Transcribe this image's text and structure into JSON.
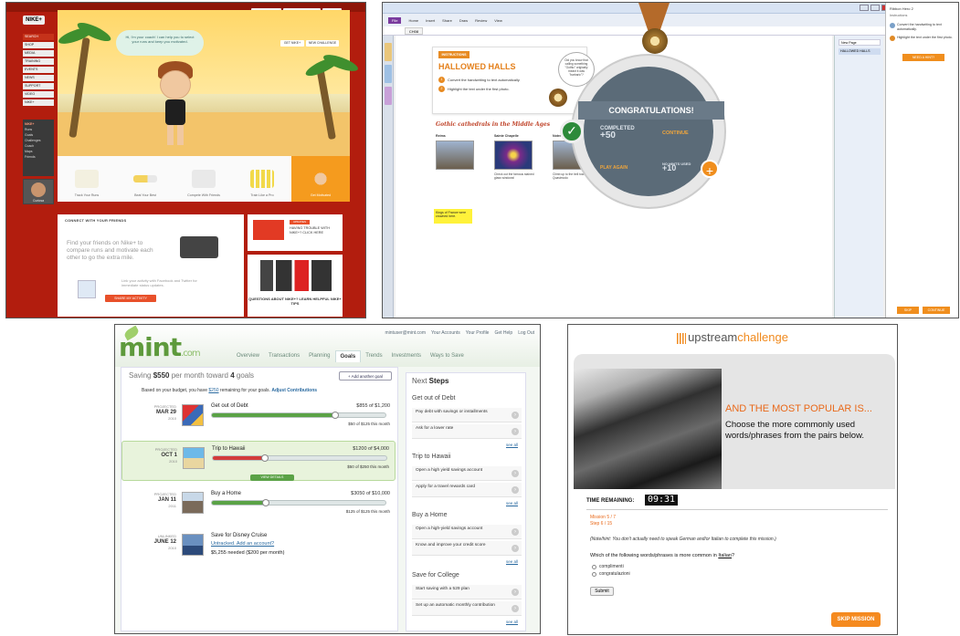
{
  "nike": {
    "logo": "NIKE+",
    "top_nav": [
      "NIKESTORE",
      "ORDER STATUS",
      "CART"
    ],
    "side_nav": [
      "SEARCH",
      "SHOP",
      "MEDIA",
      "TRAINING",
      "EVENTS",
      "NEWS",
      "SUPPORT",
      "VIDEO",
      "NIKE+"
    ],
    "side_sub_header": "NIKE+",
    "side_sub": [
      "Runs",
      "Goals",
      "Challenges",
      "Coach",
      "Maps",
      "Friends"
    ],
    "avatar_name": "Curiosa",
    "bubble": "Hi, I'm your coach! I can help you to select your runs and keep you motivated.",
    "btn_a": "GET NIKE+",
    "btn_b": "NEW CHALLENGE",
    "features": [
      "Track Your Runs",
      "Beat Your Best",
      "Compete With Friends",
      "Train Like a Pro",
      "Get Motivated"
    ],
    "connect_header": "CONNECT WITH YOUR FRIENDS",
    "connect_big": "Find your friends on Nike+ to compare runs and motivate each other to go the extra mile.",
    "connect_link": "Link your activity with Facebook and Twitter for immediate status updates.",
    "share_btn": "SHARE MY ACTIVITY",
    "promo1_tag": "UPDATES",
    "promo1_text": "HAVING TROUBLE WITH NIKE+? CLICK HERE",
    "promo2_text": "QUESTIONS ABOUT NIKE+? LEARN HELPFUL NIKE+ TIPS"
  },
  "onenote": {
    "window_title": "Ribbon Hero 2",
    "ribbon_tabs": [
      "File",
      "Home",
      "Insert",
      "Share",
      "Draw",
      "Review",
      "View"
    ],
    "section_tab": "CH08",
    "instructions_label": "INSTRUCTIONS",
    "card_title": "HALLOWED HALLS",
    "card_items": [
      "Convert the handwriting to text automatically.",
      "Highlight the text under the first photo."
    ],
    "owl_bubble": "Did you know that calling something \"Gothic\" originally meant it was \"barbaric\"?",
    "gothic_heading": "Gothic cathedrals in the Middle Ages",
    "pictures": [
      {
        "caption": "Reims",
        "desc": ""
      },
      {
        "caption": "Sainte Chapelle",
        "desc": "Check out the famous stained glass windows!"
      },
      {
        "caption": "Notre Dame",
        "desc": "Climb up to the bell tower like Quasimodo"
      }
    ],
    "highlight": "Kings of France were crowned here.",
    "congrats": "CONGRATULATIONS!",
    "completed_label": "COMPLETED",
    "completed_value": "+50",
    "continue_label": "CONTINUE",
    "play_again": "PLAY AGAIN",
    "hints_label": "NO HINTS USED",
    "hints_value": "+10",
    "new_page": "New Page",
    "page_name": "HALLOWED HALLS",
    "right_panel_title": "Ribbon Hero 2",
    "right_panel_sub": "Instructions",
    "right_items": [
      "Convert the handwriting to text automatically.",
      "Highlight the text under the first photo."
    ],
    "need_hint": "NEED A HINT?",
    "btn_skip": "SKIP",
    "btn_continue": "CONTINUE"
  },
  "mint": {
    "logo": "mint",
    "logo_domain": ".com",
    "top_links": [
      "mintuser@mint.com",
      "Your Accounts",
      "Your Profile",
      "Get Help",
      "Log Out"
    ],
    "nav": [
      "Overview",
      "Transactions",
      "Planning",
      "Goals",
      "Trends",
      "Investments",
      "Ways to Save"
    ],
    "saving_pre": "Saving ",
    "saving_amt": "$550",
    "saving_mid": " per month toward ",
    "saving_goals": "4",
    "saving_post": " goals",
    "add_goal": "+ Add another goal",
    "based_pre": "Based on your budget, you have ",
    "based_amt": "$250",
    "based_post": " remaining for your goals.",
    "adjust": "Adjust Contributions",
    "goals": [
      {
        "status": "PROJECTED",
        "date": "MAR 29",
        "year": "2010",
        "name": "Get out of Debt",
        "amount": "$855 of $1,200",
        "monthly": "$50 of $125 this month"
      },
      {
        "status": "PROJECTED",
        "date": "OCT 1",
        "year": "2010",
        "name": "Trip to Hawaii",
        "amount": "$1200 of $4,000",
        "monthly": "$50 of $250 this month",
        "view": "VIEW DETAILS"
      },
      {
        "status": "PROJECTED",
        "date": "JAN 11",
        "year": "2011",
        "name": "Buy a Home",
        "amount": "$3050 of $10,000",
        "monthly": "$125 of $125 this month"
      },
      {
        "status": "UNLINKED",
        "date": "JUNE 12",
        "year": "2010",
        "name": "Save for Disney Cruise",
        "untracked": "Untracked. Add an account?",
        "needed": "$5,255 needed ($200 per month)"
      }
    ],
    "next_pre": "Next ",
    "next_bold": "Steps",
    "sections": [
      {
        "title": "Get out of Debt",
        "steps": [
          "Pay debt with savings or installments",
          "Ask for a lower rate"
        ]
      },
      {
        "title": "Trip to Hawaii",
        "steps": [
          "Open a high yield savings account",
          "Apply for a travel rewards card"
        ]
      },
      {
        "title": "Buy a Home",
        "steps": [
          "Open a high-yield savings account",
          "Know and improve your credit score"
        ]
      },
      {
        "title": "Save for College",
        "steps": [
          "Start saving with a 529 plan",
          "Set up an automatic monthly contribution"
        ]
      }
    ],
    "see_all": "see all",
    "progress": [
      0.71,
      0.3,
      0.31
    ]
  },
  "upstream": {
    "brand_a": "upstream",
    "brand_b": "challenge",
    "headline": "AND THE MOST POPULAR IS...",
    "instruction": "Choose the more commonly used words/phrases from the pairs below.",
    "time_label": "TIME REMAINING:",
    "time_value": "09:31",
    "mission": "Mission 5 / 7",
    "step": "Step 6 / 15",
    "note": "(Note/hint: You don't actually need to speak German and/or Italian to complete this mission.)",
    "question_pre": "Which of the following words/phrases is more common in ",
    "question_lang": "Italian",
    "question_post": "?",
    "options": [
      "complimenti",
      "congratulazioni"
    ],
    "submit": "Submit",
    "skip": "SKIP MISSION"
  }
}
